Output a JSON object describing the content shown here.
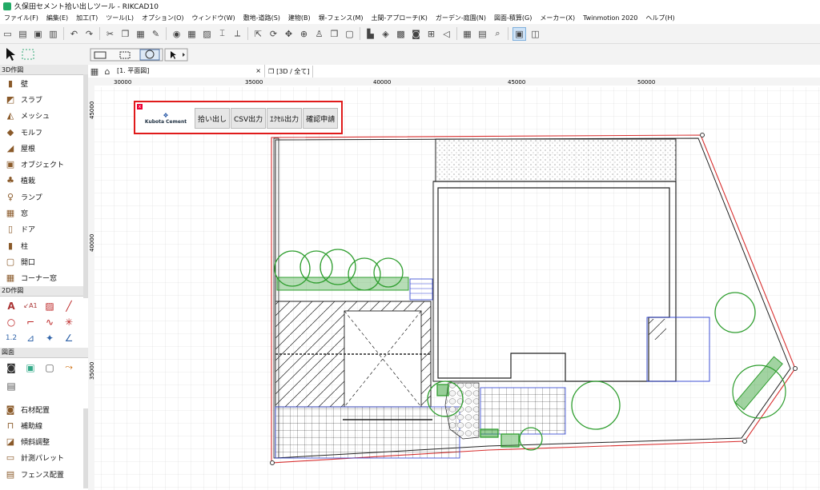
{
  "window": {
    "title": "久保田セメント拾い出しツール - RIKCAD10"
  },
  "menu": [
    "ファイル(F)",
    "編集(E)",
    "加工(T)",
    "ツール(L)",
    "オプション(O)",
    "ウィンドウ(W)",
    "敷地-道路(S)",
    "建物(B)",
    "塀-フェンス(M)",
    "土間-アプローチ(K)",
    "ガーデン-庭園(N)",
    "図面-積算(G)",
    "メーカー(X)",
    "Twinmotion 2020",
    "ヘルプ(H)"
  ],
  "sidebar": {
    "section_3d": "3D作図",
    "items_3d": [
      {
        "label": "壁",
        "icon": "wall-icon"
      },
      {
        "label": "スラブ",
        "icon": "slab-icon"
      },
      {
        "label": "メッシュ",
        "icon": "mesh-icon"
      },
      {
        "label": "モルフ",
        "icon": "morph-icon"
      },
      {
        "label": "屋根",
        "icon": "roof-icon"
      },
      {
        "label": "オブジェクト",
        "icon": "object-icon"
      },
      {
        "label": "植栽",
        "icon": "tree-icon"
      },
      {
        "label": "ランプ",
        "icon": "lamp-icon"
      },
      {
        "label": "窓",
        "icon": "window-icon"
      },
      {
        "label": "ドア",
        "icon": "door-icon"
      },
      {
        "label": "柱",
        "icon": "column-icon"
      },
      {
        "label": "開口",
        "icon": "opening-icon"
      },
      {
        "label": "コーナー窓",
        "icon": "corner-window-icon"
      }
    ],
    "section_2d": "2D作図",
    "section_drawing": "図面",
    "items_bottom": [
      {
        "label": "石材配置",
        "icon": "stone-icon"
      },
      {
        "label": "補助線",
        "icon": "guide-line-icon"
      },
      {
        "label": "傾斜調整",
        "icon": "slope-icon"
      },
      {
        "label": "計測パレット",
        "icon": "measure-icon"
      },
      {
        "label": "フェンス配置",
        "icon": "fence-icon"
      }
    ]
  },
  "tabs": [
    {
      "label": "[1. 平面図]"
    },
    {
      "label": "[3D / 全て]"
    }
  ],
  "ruler": {
    "top": [
      "30000",
      "35000",
      "40000",
      "45000",
      "50000"
    ],
    "left": [
      "45000",
      "40000",
      "35000"
    ]
  },
  "panel": {
    "logo_text": "Kubota Cement",
    "buttons": [
      "拾い出し",
      "CSV出力",
      "ｴｸｾﾙ出力",
      "確認申請"
    ]
  },
  "colors": {
    "accent_red": "#e01b1b",
    "site_line": "#d83030",
    "plant_green": "#2f9e2f",
    "blue_line": "#2b3fd1"
  }
}
